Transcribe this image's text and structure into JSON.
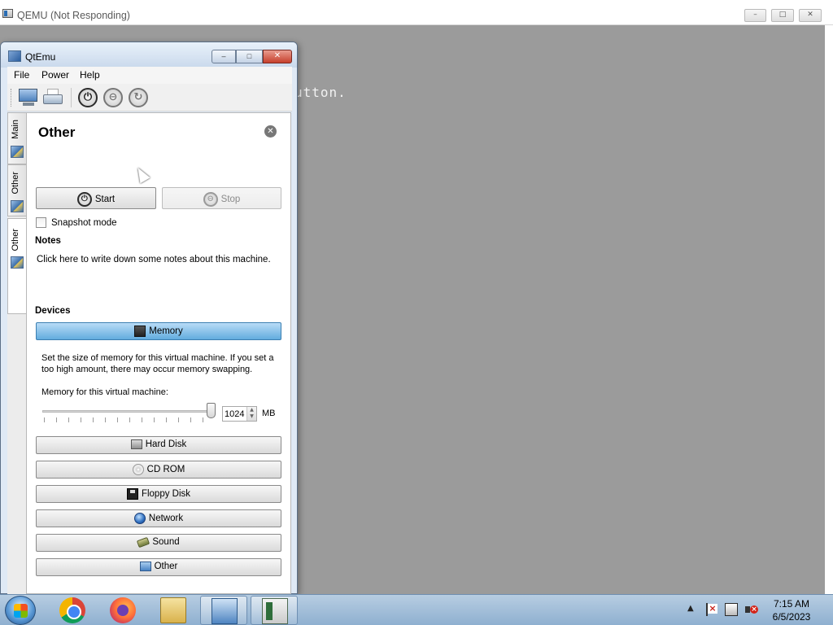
{
  "qemu_window": {
    "title": "QEMU (Not Responding)",
    "console_text": "utton.",
    "buttons": {
      "minimize": "–",
      "maximize": "□",
      "close": "✕"
    }
  },
  "qtemu": {
    "title": "QtEmu",
    "caption": {
      "minimize": "–",
      "maximize": "□",
      "close": "✕"
    },
    "menu": [
      "File",
      "Power",
      "Help"
    ],
    "toolbar": {
      "icons": [
        "monitor-icon",
        "printer-icon",
        "power-start-icon",
        "power-stop-icon",
        "power-restart-icon"
      ],
      "power_glyphs": {
        "start": "⏻",
        "stop": "⊖",
        "restart": "↻"
      }
    },
    "tabs": [
      "Main",
      "Other",
      "Other"
    ],
    "panel": {
      "title": "Other",
      "close_glyph": "✕",
      "start_label": "Start",
      "stop_label": "Stop",
      "snapshot_label": "Snapshot mode",
      "snapshot_checked": false,
      "notes_heading": "Notes",
      "notes_text": "Click here to write down some notes about this machine.",
      "devices_heading": "Devices",
      "devices": [
        "Memory",
        "Hard Disk",
        "CD ROM",
        "Floppy Disk",
        "Network",
        "Sound",
        "Other"
      ],
      "memory": {
        "description": "Set the size of memory for this virtual machine. If you set a too high amount, there may occur memory swapping.",
        "label": "Memory for this virtual machine:",
        "value": "1024",
        "unit": "MB",
        "spin_up": "▲",
        "spin_down": "▼"
      }
    }
  },
  "taskbar": {
    "apps": [
      "chrome-icon",
      "firefox-icon",
      "file-explorer-icon",
      "qtemu-icon",
      "qemu-icon"
    ],
    "active_app": "qtemu",
    "tray_chevron": "▲",
    "clock_time": "7:15 AM",
    "clock_date": "6/5/2023"
  },
  "colors": {
    "desktop_gray": "#9b9b9b",
    "memory_highlight": "#62acde",
    "title_blue": "#c9d9ec",
    "taskbar": "#8fb0d0"
  }
}
